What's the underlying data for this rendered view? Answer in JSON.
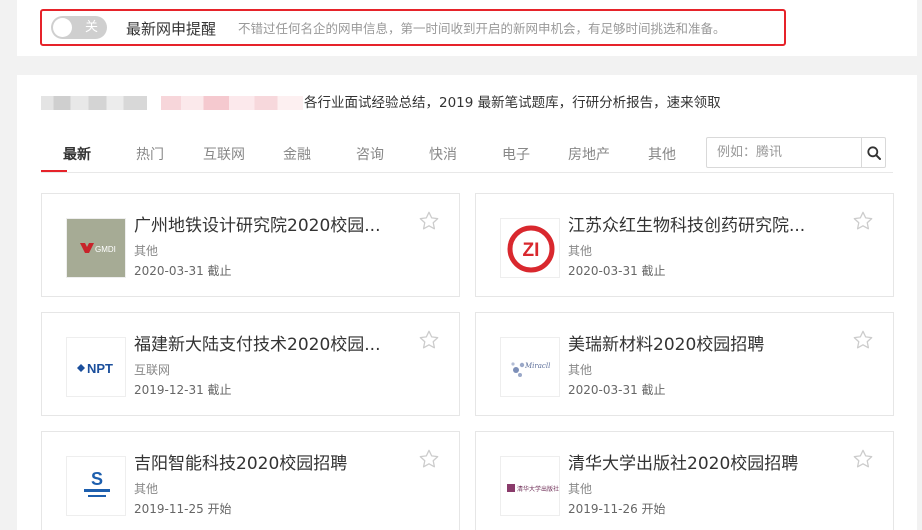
{
  "alert": {
    "toggle_label": "关",
    "title": "最新网申提醒",
    "description": "不错过任何名企的网申信息，第一时间收到开启的新网申机会，有足够时间挑选和准备。"
  },
  "banner": {
    "text": "各行业面试经验总结，2019 最新笔试题库，行研分析报告，速来领取"
  },
  "tabs": [
    {
      "label": "最新"
    },
    {
      "label": "热门"
    },
    {
      "label": "互联网"
    },
    {
      "label": "金融"
    },
    {
      "label": "咨询"
    },
    {
      "label": "快消"
    },
    {
      "label": "电子"
    },
    {
      "label": "房地产"
    },
    {
      "label": "其他"
    }
  ],
  "search": {
    "placeholder": "例如：腾讯",
    "icon": "search-icon"
  },
  "cards": [
    {
      "title": "广州地铁设计研究院2020校园...",
      "category": "其他",
      "date": "2020-03-31 截止",
      "logo_text": "GMDI",
      "logo_bg": "#a6ab95"
    },
    {
      "title": "江苏众红生物科技创药研究院...",
      "category": "其他",
      "date": "2020-03-31 截止",
      "logo_text": "ZI",
      "logo_bg": "#ffffff"
    },
    {
      "title": "福建新大陆支付技术2020校园...",
      "category": "互联网",
      "date": "2019-12-31 截止",
      "logo_text": "NPT",
      "logo_bg": "#ffffff"
    },
    {
      "title": "美瑞新材料2020校园招聘",
      "category": "其他",
      "date": "2020-03-31 截止",
      "logo_text": "Miracll",
      "logo_bg": "#ffffff"
    },
    {
      "title": "吉阳智能科技2020校园招聘",
      "category": "其他",
      "date": "2019-11-25 开始",
      "logo_text": "S",
      "logo_bg": "#ffffff"
    },
    {
      "title": "清华大学出版社2020校园招聘",
      "category": "其他",
      "date": "2019-11-26 开始",
      "logo_text": "清华大学出版社",
      "logo_bg": "#ffffff"
    }
  ],
  "colors": {
    "accent": "#e6232a",
    "toggle_off": "#cfcfcf"
  }
}
